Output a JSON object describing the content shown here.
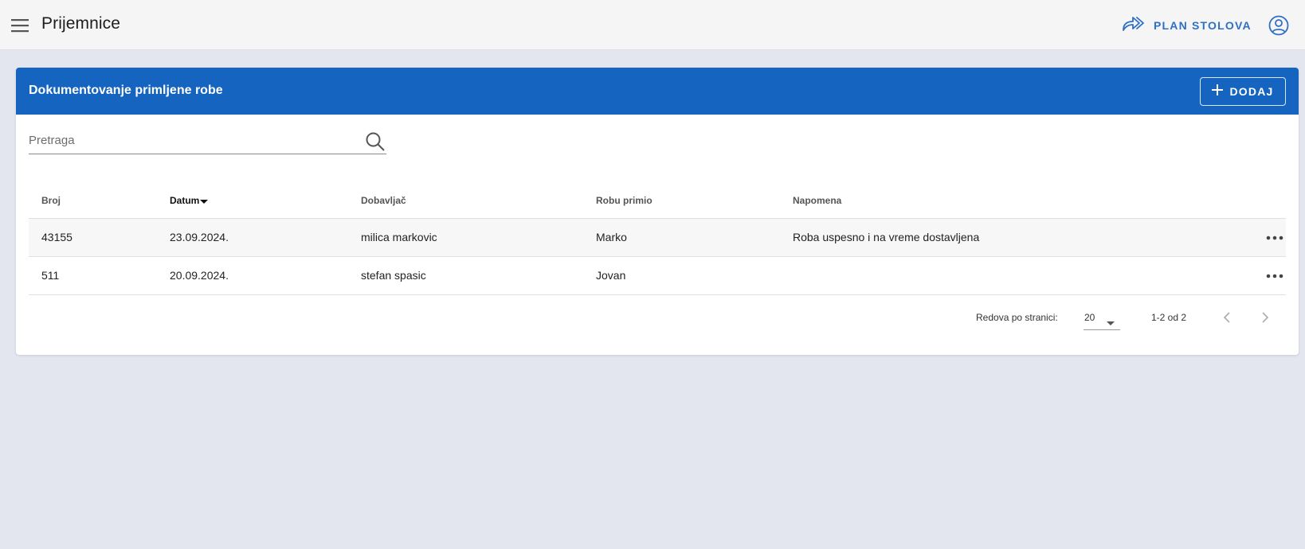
{
  "appbar": {
    "title": "Prijemnice",
    "plan_button": "PLAN STOLOVA",
    "menu_icon": "hamburger-menu-icon",
    "plan_icon": "double-forward-arrow-icon",
    "account_icon": "account-circle-icon"
  },
  "card": {
    "title": "Dokumentovanje primljene robe",
    "add_button": "DODAJ",
    "header_color": "#1565c0"
  },
  "search": {
    "placeholder": "Pretraga",
    "value": ""
  },
  "table": {
    "columns": [
      "Broj",
      "Datum",
      "Dobavljač",
      "Robu primio",
      "Napomena"
    ],
    "sorted_column": "Datum",
    "sort_direction": "descending",
    "rows": [
      [
        "43155",
        "23.09.2024.",
        "milica markovic",
        "Marko",
        "Roba uspesno i na vreme dostavljena"
      ],
      [
        "511",
        "20.09.2024.",
        "stefan spasic",
        "Jovan",
        ""
      ]
    ]
  },
  "pagination": {
    "rows_label": "Redova po stranici:",
    "rows_per_page": "20",
    "range": "1-2 od 2"
  },
  "colors": {
    "accent": "#1565c0",
    "link": "#2f6fc4",
    "background": "#e3e6ef"
  }
}
